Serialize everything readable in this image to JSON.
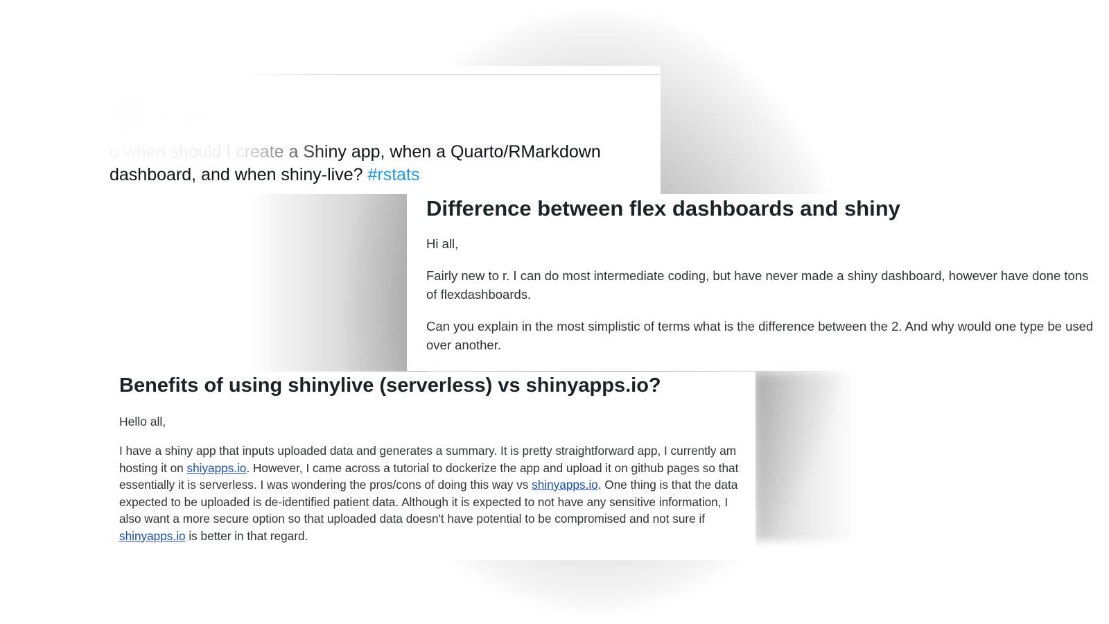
{
  "post": {
    "author_name": "",
    "handle": "bsky.social",
    "text_prefix": "o when should I create a Shiny app, when a Quarto/RMarkdown dashboard, and when shiny-live?",
    "hashtag": "#rstats"
  },
  "forum_question": {
    "title": "Difference between flex dashboards and shiny",
    "greeting": "Hi all,",
    "paragraph_1": "Fairly new to r. I can do most intermediate coding, but have never made a shiny dashboard, however have done tons of flexdashboards.",
    "paragraph_2": "Can you explain in the most simplistic of terms what is the difference between the 2. And why would one type be used over another."
  },
  "forum_question_2": {
    "title": "Benefits of using shinylive (serverless) vs shinyapps.io?",
    "greeting": "Hello all,",
    "seg_1": "I have a shiny app that inputs uploaded data and generates a summary. It is pretty straightforward app, I currently am hosting it on ",
    "link_1": "shiyapps.io",
    "seg_2": ". However, I came across a tutorial to dockerize the app and upload it on github pages so that essentially it is serverless. I was wondering the pros/cons of doing this way vs ",
    "link_2": "shinyapps.io",
    "seg_3": ". One thing is that the data expected to be uploaded is de-identified patient data. Although it is expected to not have any sensitive information, I also want a more secure option so that uploaded data doesn't have potential to be compromised and not sure if ",
    "link_3": "shinyapps.io",
    "seg_4": " is better in that regard."
  },
  "colors": {
    "hashtag": "#1d9bf0",
    "link": "#1a4fb4",
    "heading": "#1c2328"
  }
}
